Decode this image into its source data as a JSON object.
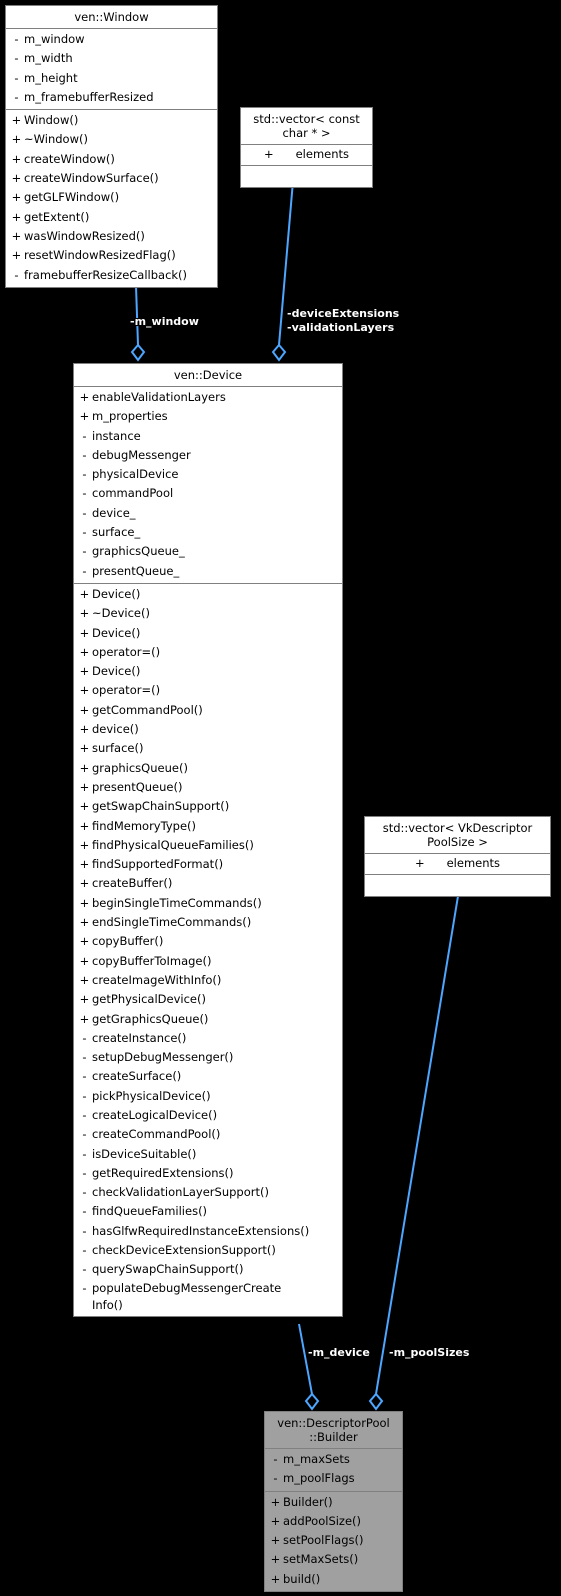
{
  "diagram": {
    "title": "UML collaboration diagram",
    "edge_color": "#4DA6FF",
    "box_border_color": "#808080",
    "highlight_fill": "#A0A0A0",
    "background": "#000000"
  },
  "classes": {
    "window": {
      "name": "ven::Window",
      "attributes": [
        {
          "vis": "-",
          "name": "m_window"
        },
        {
          "vis": "-",
          "name": "m_width"
        },
        {
          "vis": "-",
          "name": "m_height"
        },
        {
          "vis": "-",
          "name": "m_framebufferResized"
        }
      ],
      "methods": [
        {
          "vis": "+",
          "name": "Window()"
        },
        {
          "vis": "+",
          "name": "~Window()"
        },
        {
          "vis": "+",
          "name": "createWindow()"
        },
        {
          "vis": "+",
          "name": "createWindowSurface()"
        },
        {
          "vis": "+",
          "name": "getGLFWindow()"
        },
        {
          "vis": "+",
          "name": "getExtent()"
        },
        {
          "vis": "+",
          "name": "wasWindowResized()"
        },
        {
          "vis": "+",
          "name": "resetWindowResizedFlag()"
        },
        {
          "vis": "-",
          "name": "framebufferResizeCallback()"
        }
      ]
    },
    "vector_const_char": {
      "name": "std::vector< const\nchar * >",
      "attributes": [
        {
          "vis": "+",
          "name": "elements"
        }
      ],
      "methods": []
    },
    "device": {
      "name": "ven::Device",
      "attributes": [
        {
          "vis": "+",
          "name": "enableValidationLayers"
        },
        {
          "vis": "+",
          "name": "m_properties"
        },
        {
          "vis": "-",
          "name": "instance"
        },
        {
          "vis": "-",
          "name": "debugMessenger"
        },
        {
          "vis": "-",
          "name": "physicalDevice"
        },
        {
          "vis": "-",
          "name": "commandPool"
        },
        {
          "vis": "-",
          "name": "device_"
        },
        {
          "vis": "-",
          "name": "surface_"
        },
        {
          "vis": "-",
          "name": "graphicsQueue_"
        },
        {
          "vis": "-",
          "name": "presentQueue_"
        }
      ],
      "methods": [
        {
          "vis": "+",
          "name": "Device()"
        },
        {
          "vis": "+",
          "name": "~Device()"
        },
        {
          "vis": "+",
          "name": "Device()"
        },
        {
          "vis": "+",
          "name": "operator=()"
        },
        {
          "vis": "+",
          "name": "Device()"
        },
        {
          "vis": "+",
          "name": "operator=()"
        },
        {
          "vis": "+",
          "name": "getCommandPool()"
        },
        {
          "vis": "+",
          "name": "device()"
        },
        {
          "vis": "+",
          "name": "surface()"
        },
        {
          "vis": "+",
          "name": "graphicsQueue()"
        },
        {
          "vis": "+",
          "name": "presentQueue()"
        },
        {
          "vis": "+",
          "name": "getSwapChainSupport()"
        },
        {
          "vis": "+",
          "name": "findMemoryType()"
        },
        {
          "vis": "+",
          "name": "findPhysicalQueueFamilies()"
        },
        {
          "vis": "+",
          "name": "findSupportedFormat()"
        },
        {
          "vis": "+",
          "name": "createBuffer()"
        },
        {
          "vis": "+",
          "name": "beginSingleTimeCommands()"
        },
        {
          "vis": "+",
          "name": "endSingleTimeCommands()"
        },
        {
          "vis": "+",
          "name": "copyBuffer()"
        },
        {
          "vis": "+",
          "name": "copyBufferToImage()"
        },
        {
          "vis": "+",
          "name": "createImageWithInfo()"
        },
        {
          "vis": "+",
          "name": "getPhysicalDevice()"
        },
        {
          "vis": "+",
          "name": "getGraphicsQueue()"
        },
        {
          "vis": "-",
          "name": "createInstance()"
        },
        {
          "vis": "-",
          "name": "setupDebugMessenger()"
        },
        {
          "vis": "-",
          "name": "createSurface()"
        },
        {
          "vis": "-",
          "name": "pickPhysicalDevice()"
        },
        {
          "vis": "-",
          "name": "createLogicalDevice()"
        },
        {
          "vis": "-",
          "name": "createCommandPool()"
        },
        {
          "vis": "-",
          "name": "isDeviceSuitable()"
        },
        {
          "vis": "-",
          "name": "getRequiredExtensions()"
        },
        {
          "vis": "-",
          "name": "checkValidationLayerSupport()"
        },
        {
          "vis": "-",
          "name": "findQueueFamilies()"
        },
        {
          "vis": "-",
          "name": "hasGlfwRequiredInstanceExtensions()"
        },
        {
          "vis": "-",
          "name": "checkDeviceExtensionSupport()"
        },
        {
          "vis": "-",
          "name": "querySwapChainSupport()"
        },
        {
          "vis": "-",
          "name": "populateDebugMessengerCreate\nInfo()"
        }
      ]
    },
    "vector_pool_size": {
      "name": "std::vector< VkDescriptor\nPoolSize >",
      "attributes": [
        {
          "vis": "+",
          "name": "elements"
        }
      ],
      "methods": []
    },
    "descriptor_pool_builder": {
      "name": "ven::DescriptorPool\n::Builder",
      "attributes": [
        {
          "vis": "-",
          "name": "m_maxSets"
        },
        {
          "vis": "-",
          "name": "m_poolFlags"
        }
      ],
      "methods": [
        {
          "vis": "+",
          "name": "Builder()"
        },
        {
          "vis": "+",
          "name": "addPoolSize()"
        },
        {
          "vis": "+",
          "name": "setPoolFlags()"
        },
        {
          "vis": "+",
          "name": "setMaxSets()"
        },
        {
          "vis": "+",
          "name": "build()"
        }
      ]
    }
  },
  "edges": [
    {
      "id": "window-device",
      "label": "-m_window"
    },
    {
      "id": "vector-device",
      "label": "-deviceExtensions\n-validationLayers"
    },
    {
      "id": "device-builder",
      "label": "-m_device"
    },
    {
      "id": "poolsize-builder",
      "label": "-m_poolSizes"
    }
  ]
}
